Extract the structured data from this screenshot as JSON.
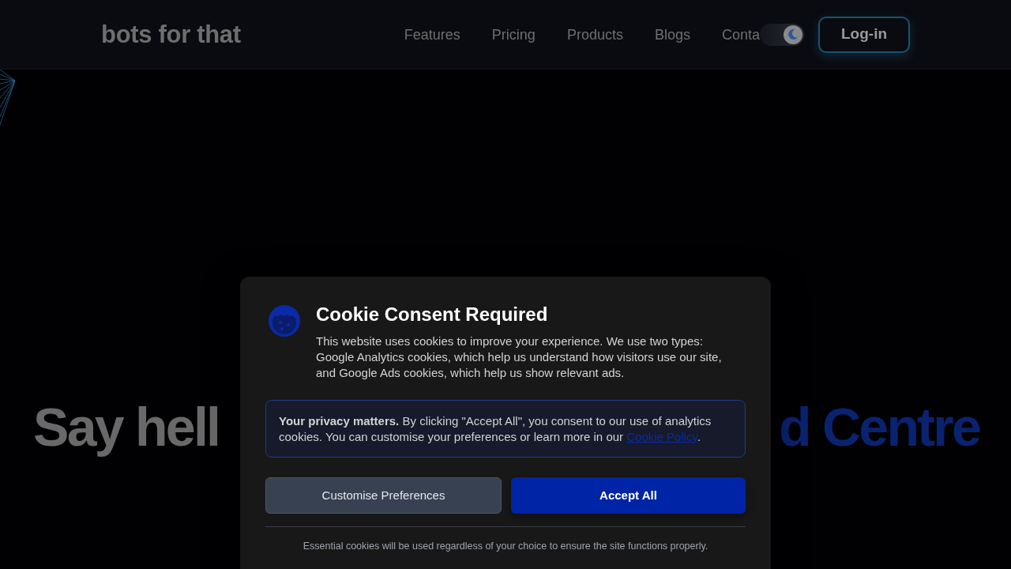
{
  "header": {
    "logo": "bots for that",
    "nav": [
      {
        "label": "Features"
      },
      {
        "label": "Pricing"
      },
      {
        "label": "Products"
      },
      {
        "label": "Blogs"
      },
      {
        "label": "Conta"
      }
    ],
    "theme_toggle": {
      "on": true
    },
    "login_button": "Log-in"
  },
  "hero": {
    "headline_left": "Say hell",
    "headline_right": "d Centre"
  },
  "cookie_dialog": {
    "title": "Cookie Consent Required",
    "description": "This website uses cookies to improve your experience. We use two types: Google Analytics cookies, which help us understand how visitors use our site, and Google Ads cookies, which help us show relevant ads.",
    "notice": {
      "text": "**Your privacy matters.** By clicking \"Accept All\", you consent to our use of analytics cookies. You can customise your preferences or learn more in our ",
      "link": "Cookie Policy",
      "text_after": "."
    },
    "buttons": [
      {
        "label": "Customise Preferences",
        "kind": "secondary"
      },
      {
        "label": "Accept All",
        "kind": "primary"
      }
    ],
    "footnote": "Essential cookies will be used regardless of your choice to ensure the site functions properly."
  }
}
